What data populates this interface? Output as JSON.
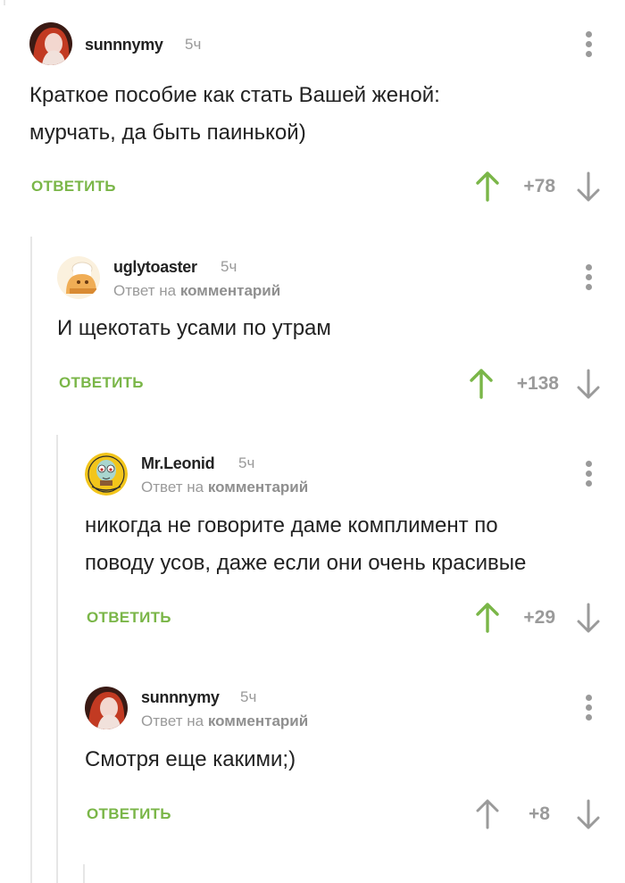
{
  "comments": [
    {
      "username": "sunnnymy",
      "time": "5ч",
      "text_lines": [
        "Краткое пособие как стать Вашей женой:",
        "мурчать, да быть паинькой)"
      ],
      "reply_label": "ОТВЕТИТЬ",
      "rating": "+78",
      "upvoted": true
    },
    {
      "username": "uglytoaster",
      "time": "5ч",
      "reply_prefix": "Ответ на",
      "reply_link": "комментарий",
      "text_lines": [
        "И щекотать усами по утрам"
      ],
      "reply_label": "ОТВЕТИТЬ",
      "rating": "+138",
      "upvoted": true
    },
    {
      "username": "Mr.Leonid",
      "time": "5ч",
      "reply_prefix": "Ответ на",
      "reply_link": "комментарий",
      "text_lines": [
        "никогда не говорите даме комплимент по",
        "поводу усов, даже если они очень красивые"
      ],
      "reply_label": "ОТВЕТИТЬ",
      "rating": "+29",
      "upvoted": true
    },
    {
      "username": "sunnnymy",
      "time": "5ч",
      "reply_prefix": "Ответ на",
      "reply_link": "комментарий",
      "text_lines": [
        "Смотря еще какими;)"
      ],
      "reply_label": "ОТВЕТИТЬ",
      "rating": "+8",
      "upvoted": false
    }
  ],
  "icons": {
    "more": "kebab-menu-icon",
    "upvote": "arrow-up-icon",
    "downvote": "arrow-down-icon"
  },
  "colors": {
    "accent_green": "#7ab648",
    "muted_gray": "#9a9a9a",
    "thread_line": "#e6e6e6"
  }
}
